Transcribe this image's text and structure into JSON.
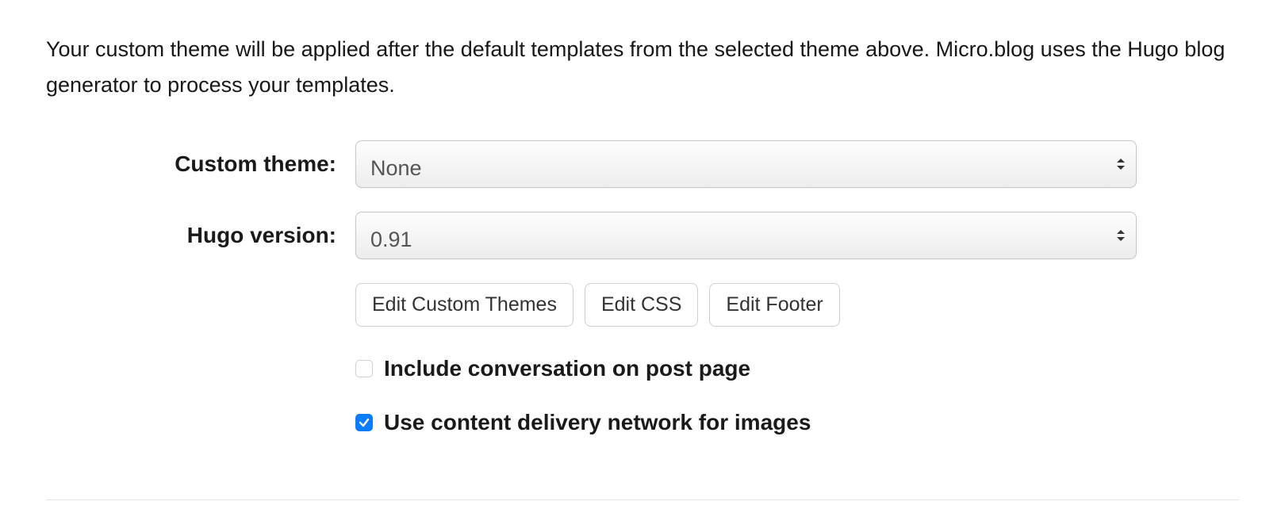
{
  "intro": "Your custom theme will be applied after the default templates from the selected theme above. Micro.blog uses the Hugo blog generator to process your templates.",
  "fields": {
    "custom_theme": {
      "label": "Custom theme:",
      "value": "None"
    },
    "hugo_version": {
      "label": "Hugo version:",
      "value": "0.91"
    }
  },
  "buttons": {
    "edit_custom_themes": "Edit Custom Themes",
    "edit_css": "Edit CSS",
    "edit_footer": "Edit Footer"
  },
  "checkboxes": {
    "include_conversation": {
      "label": "Include conversation on post page",
      "checked": false
    },
    "use_cdn": {
      "label": "Use content delivery network for images",
      "checked": true
    }
  }
}
